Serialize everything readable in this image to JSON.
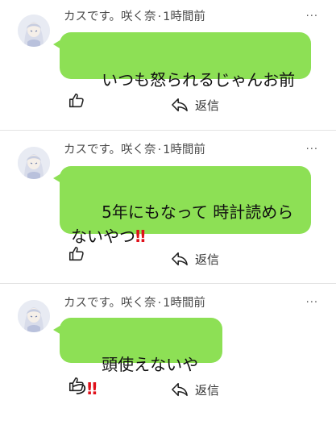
{
  "posts": [
    {
      "author": "カスです。咲く奈",
      "separator": "·",
      "time": "1時間前",
      "message_text": "いつも怒られるじゃんお前",
      "message_emoji": "",
      "more_label": "···",
      "reply_label": "返信"
    },
    {
      "author": "カスです。咲く奈",
      "separator": "·",
      "time": "1時間前",
      "message_text": "5年にもなって 時計読めらないやつ",
      "message_emoji": "‼",
      "more_label": "···",
      "reply_label": "返信"
    },
    {
      "author": "カスです。咲く奈",
      "separator": "·",
      "time": "1時間前",
      "message_text": "頭使えないやつ",
      "message_emoji": "‼",
      "more_label": "···",
      "reply_label": "返信"
    }
  ],
  "colors": {
    "bubble": "#8de055",
    "emoji_red": "#e0101a",
    "meta_text": "#4a4a4a",
    "divider": "#e3e3e3"
  },
  "icons": {
    "like": "thumbs-up-outline-icon",
    "reply": "reply-arrow-icon",
    "more": "ellipsis-icon"
  }
}
